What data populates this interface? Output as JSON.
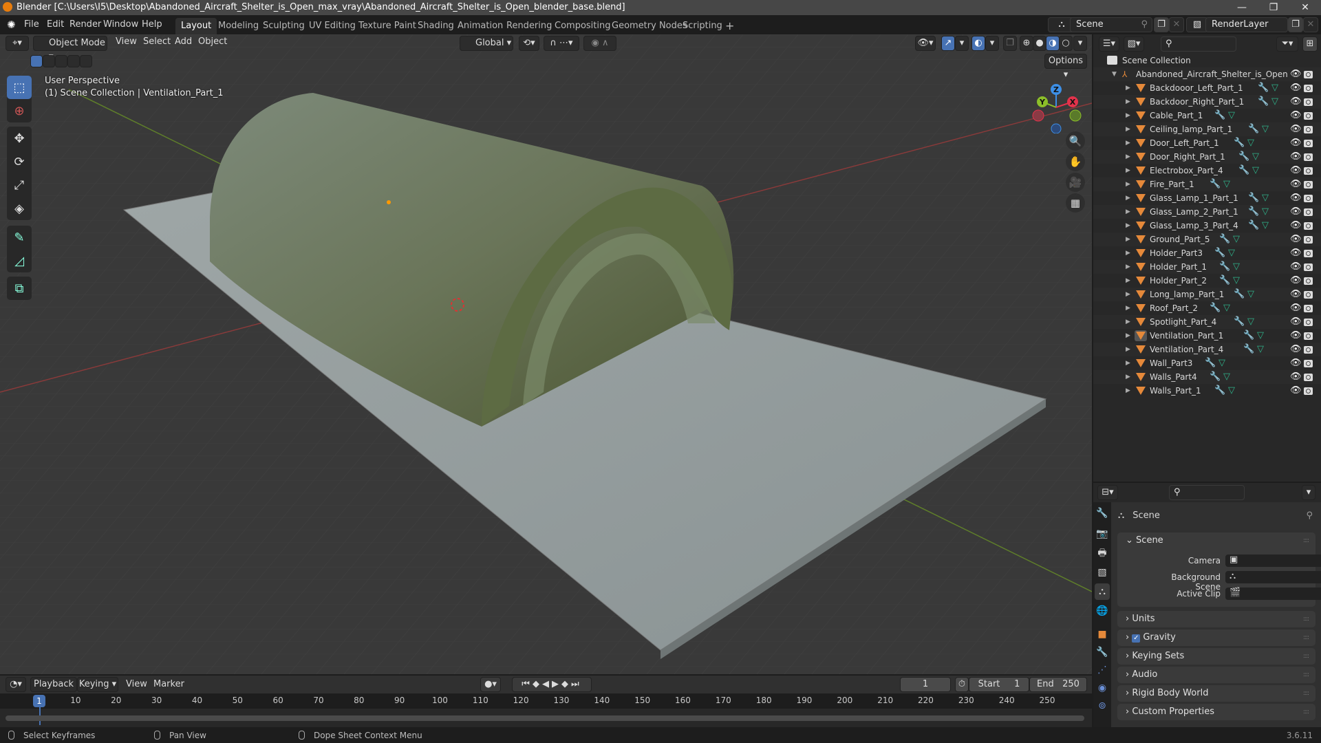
{
  "window": {
    "title": "Blender [C:\\Users\\I5\\Desktop\\Abandoned_Aircraft_Shelter_is_Open_max_vray\\Abandoned_Aircraft_Shelter_is_Open_blender_base.blend]",
    "minimize": "—",
    "maximize": "❐",
    "close": "✕"
  },
  "menubar": {
    "menus": [
      "File",
      "Edit",
      "Render",
      "Window",
      "Help"
    ],
    "workspaces": [
      "Layout",
      "Modeling",
      "Sculpting",
      "UV Editing",
      "Texture Paint",
      "Shading",
      "Animation",
      "Rendering",
      "Compositing",
      "Geometry Nodes",
      "Scripting"
    ],
    "active_workspace": "Layout",
    "add_workspace": "+",
    "scene_name": "Scene",
    "view_layer_name": "RenderLayer"
  },
  "viewport": {
    "mode": "Object Mode",
    "menus": [
      "View",
      "Select",
      "Add",
      "Object"
    ],
    "transform_orientation": "Global",
    "options_label": "Options",
    "perspective_label": "User Perspective",
    "context_label": "(1) Scene Collection | Ventilation_Part_1",
    "gizmo_axes": {
      "x": "X",
      "y": "Y",
      "z": "Z"
    },
    "colors": {
      "x": "#e3324b",
      "y": "#8cbf29",
      "z": "#3d8fe6",
      "accent": "#4772b3"
    }
  },
  "toolbar": {
    "tools": [
      {
        "name": "select-box",
        "glyph": "⬚"
      },
      {
        "name": "cursor",
        "glyph": "⊕"
      },
      {
        "name": "move",
        "glyph": "✥"
      },
      {
        "name": "rotate",
        "glyph": "⟳"
      },
      {
        "name": "scale",
        "glyph": "⤢"
      },
      {
        "name": "transform",
        "glyph": "◈"
      },
      {
        "name": "annotate",
        "glyph": "✎"
      },
      {
        "name": "measure",
        "glyph": "📐"
      },
      {
        "name": "add-cube",
        "glyph": "⧉"
      }
    ]
  },
  "outliner": {
    "root": "Scene Collection",
    "collection": "Abandoned_Aircraft_Shelter_is_Open",
    "objects": [
      "Backdooor_Left_Part_1",
      "Backdoor_Right_Part_1",
      "Cable_Part_1",
      "Ceiling_lamp_Part_1",
      "Door_Left_Part_1",
      "Door_Right_Part_1",
      "Electrobox_Part_4",
      "Fire_Part_1",
      "Glass_Lamp_1_Part_1",
      "Glass_Lamp_2_Part_1",
      "Glass_Lamp_3_Part_4",
      "Ground_Part_5",
      "Holder_Part3",
      "Holder_Part_1",
      "Holder_Part_2",
      "Long_lamp_Part_1",
      "Roof_Part_2",
      "Spotlight_Part_4",
      "Ventilation_Part_1",
      "Ventilation_Part_4",
      "Wall_Part3",
      "Walls_Part4",
      "Walls_Part_1"
    ],
    "active_object": "Ventilation_Part_1"
  },
  "properties": {
    "context": "Scene",
    "panel_title": "Scene",
    "fields": [
      {
        "label": "Camera",
        "value": ""
      },
      {
        "label": "Background Scene",
        "value": ""
      },
      {
        "label": "Active Clip",
        "value": ""
      }
    ],
    "collapsed_panels": [
      "Units",
      "Gravity",
      "Keying Sets",
      "Audio",
      "Rigid Body World",
      "Custom Properties"
    ],
    "gravity_enabled": true
  },
  "timeline": {
    "menus": [
      "Playback",
      "Keying",
      "View",
      "Marker"
    ],
    "current_frame": "1",
    "start_label": "Start",
    "start": "1",
    "end_label": "End",
    "end": "250",
    "ticks": [
      "10",
      "20",
      "30",
      "40",
      "50",
      "60",
      "70",
      "80",
      "90",
      "100",
      "110",
      "120",
      "130",
      "140",
      "150",
      "160",
      "170",
      "180",
      "190",
      "200",
      "210",
      "220",
      "230",
      "240",
      "250"
    ]
  },
  "statusbar": {
    "hints": [
      "Select Keyframes",
      "Pan View",
      "Dope Sheet Context Menu"
    ],
    "version": "3.6.11"
  }
}
